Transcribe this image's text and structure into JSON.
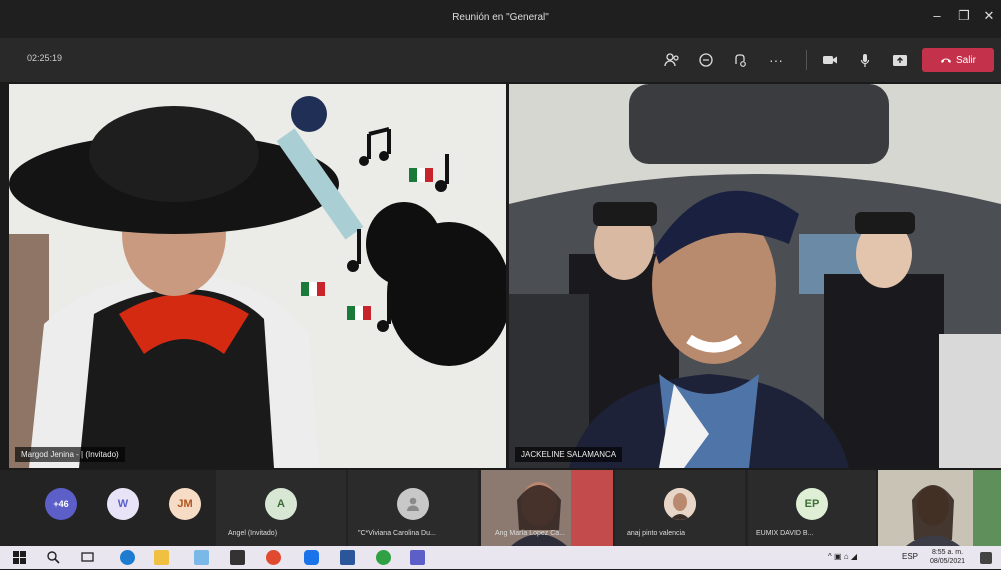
{
  "window": {
    "title": "Reunión en \"General\"",
    "minimize": "–",
    "maximize": "❐",
    "close": "✕"
  },
  "toolbar": {
    "timer": "02:25:19",
    "leave_label": "Salir",
    "more": "···"
  },
  "main_tiles": [
    {
      "name": "Margod Jenina - | (Invitado)"
    },
    {
      "name": "JACKELINE SALAMANCA"
    }
  ],
  "strip": {
    "more_count": "+46",
    "participants": [
      {
        "initials": "W",
        "color": "#e8e3f7",
        "text_color": "#5b5fc7"
      },
      {
        "initials": "JM",
        "color": "#f6dcc4",
        "text_color": "#b2541c"
      },
      {
        "initials": "A",
        "name": "Angel (Invitado)",
        "color": "#d7e7d4",
        "text_color": "#3e6b36"
      },
      {
        "name": "\"C*Viviana Carolina Du...",
        "color": "#c8c8c8"
      },
      {
        "name": "Ang María Lopez Ca..."
      },
      {
        "name": "anaj pinto valencia"
      },
      {
        "initials": "EP",
        "name": "EUMIX DAVID B...",
        "color": "#dfefd6",
        "text_color": "#3e6b36"
      }
    ]
  },
  "taskbar": {
    "language": "ESP",
    "time": "8:55 a. m.",
    "date": "08/05/2021",
    "tray_icons": "^ ▣ ⌂ ◢"
  }
}
